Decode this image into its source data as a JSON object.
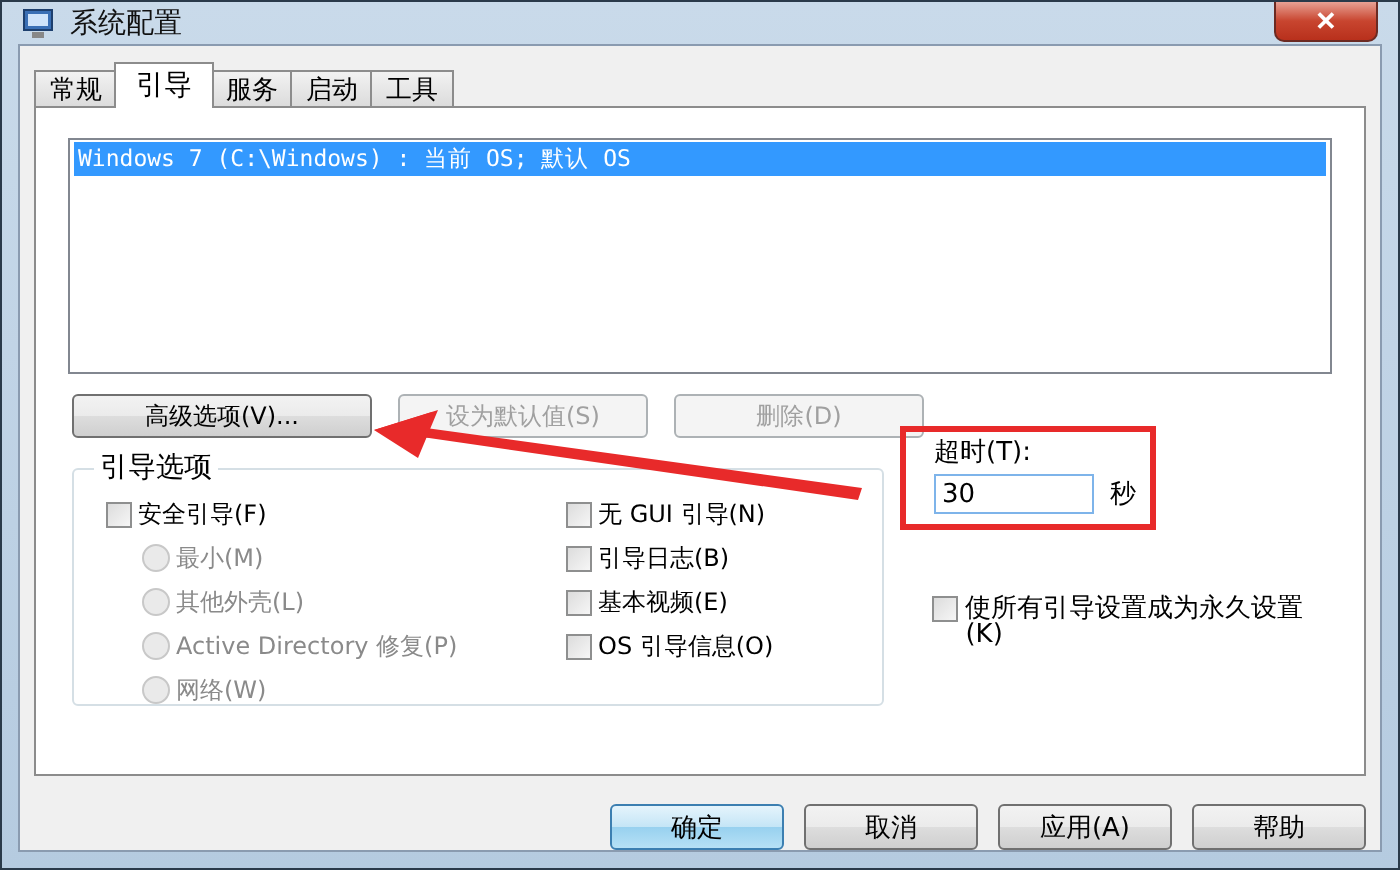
{
  "window": {
    "title": "系统配置",
    "close": "✕"
  },
  "tabs": [
    {
      "label": "常规",
      "selected": false
    },
    {
      "label": "引导",
      "selected": true
    },
    {
      "label": "服务",
      "selected": false
    },
    {
      "label": "启动",
      "selected": false
    },
    {
      "label": "工具",
      "selected": false
    }
  ],
  "boot_list": [
    {
      "text": "Windows 7 (C:\\Windows) : 当前 OS; 默认 OS",
      "selected": true
    }
  ],
  "list_buttons": [
    {
      "label": "高级选项(V)...",
      "disabled": false
    },
    {
      "label": "设为默认值(S)",
      "disabled": true
    },
    {
      "label": "删除(D)",
      "disabled": true
    }
  ],
  "boot_options": {
    "title": "引导选项",
    "left": [
      {
        "kind": "checkbox",
        "label": "安全引导(F)",
        "checked": false,
        "disabled": false
      },
      {
        "kind": "radio",
        "label": "最小(M)",
        "selected": false,
        "disabled": true
      },
      {
        "kind": "radio",
        "label": "其他外壳(L)",
        "selected": false,
        "disabled": true
      },
      {
        "kind": "radio",
        "label": "Active Directory 修复(P)",
        "selected": false,
        "disabled": true
      },
      {
        "kind": "radio",
        "label": "网络(W)",
        "selected": false,
        "disabled": true
      }
    ],
    "right": [
      {
        "kind": "checkbox",
        "label": "无 GUI 引导(N)",
        "checked": false,
        "disabled": false
      },
      {
        "kind": "checkbox",
        "label": "引导日志(B)",
        "checked": false,
        "disabled": false
      },
      {
        "kind": "checkbox",
        "label": "基本视频(E)",
        "checked": false,
        "disabled": false
      },
      {
        "kind": "checkbox",
        "label": "OS 引导信息(O)",
        "checked": false,
        "disabled": false
      }
    ]
  },
  "timeout": {
    "label": "超时(T):",
    "value": "30",
    "unit": "秒"
  },
  "permanent": {
    "label": "使所有引导设置成为永久设置(K)",
    "checked": false
  },
  "buttons": [
    {
      "label": "确定",
      "default": true
    },
    {
      "label": "取消",
      "default": false
    },
    {
      "label": "应用(A)",
      "default": false
    },
    {
      "label": "帮助",
      "default": false
    }
  ]
}
